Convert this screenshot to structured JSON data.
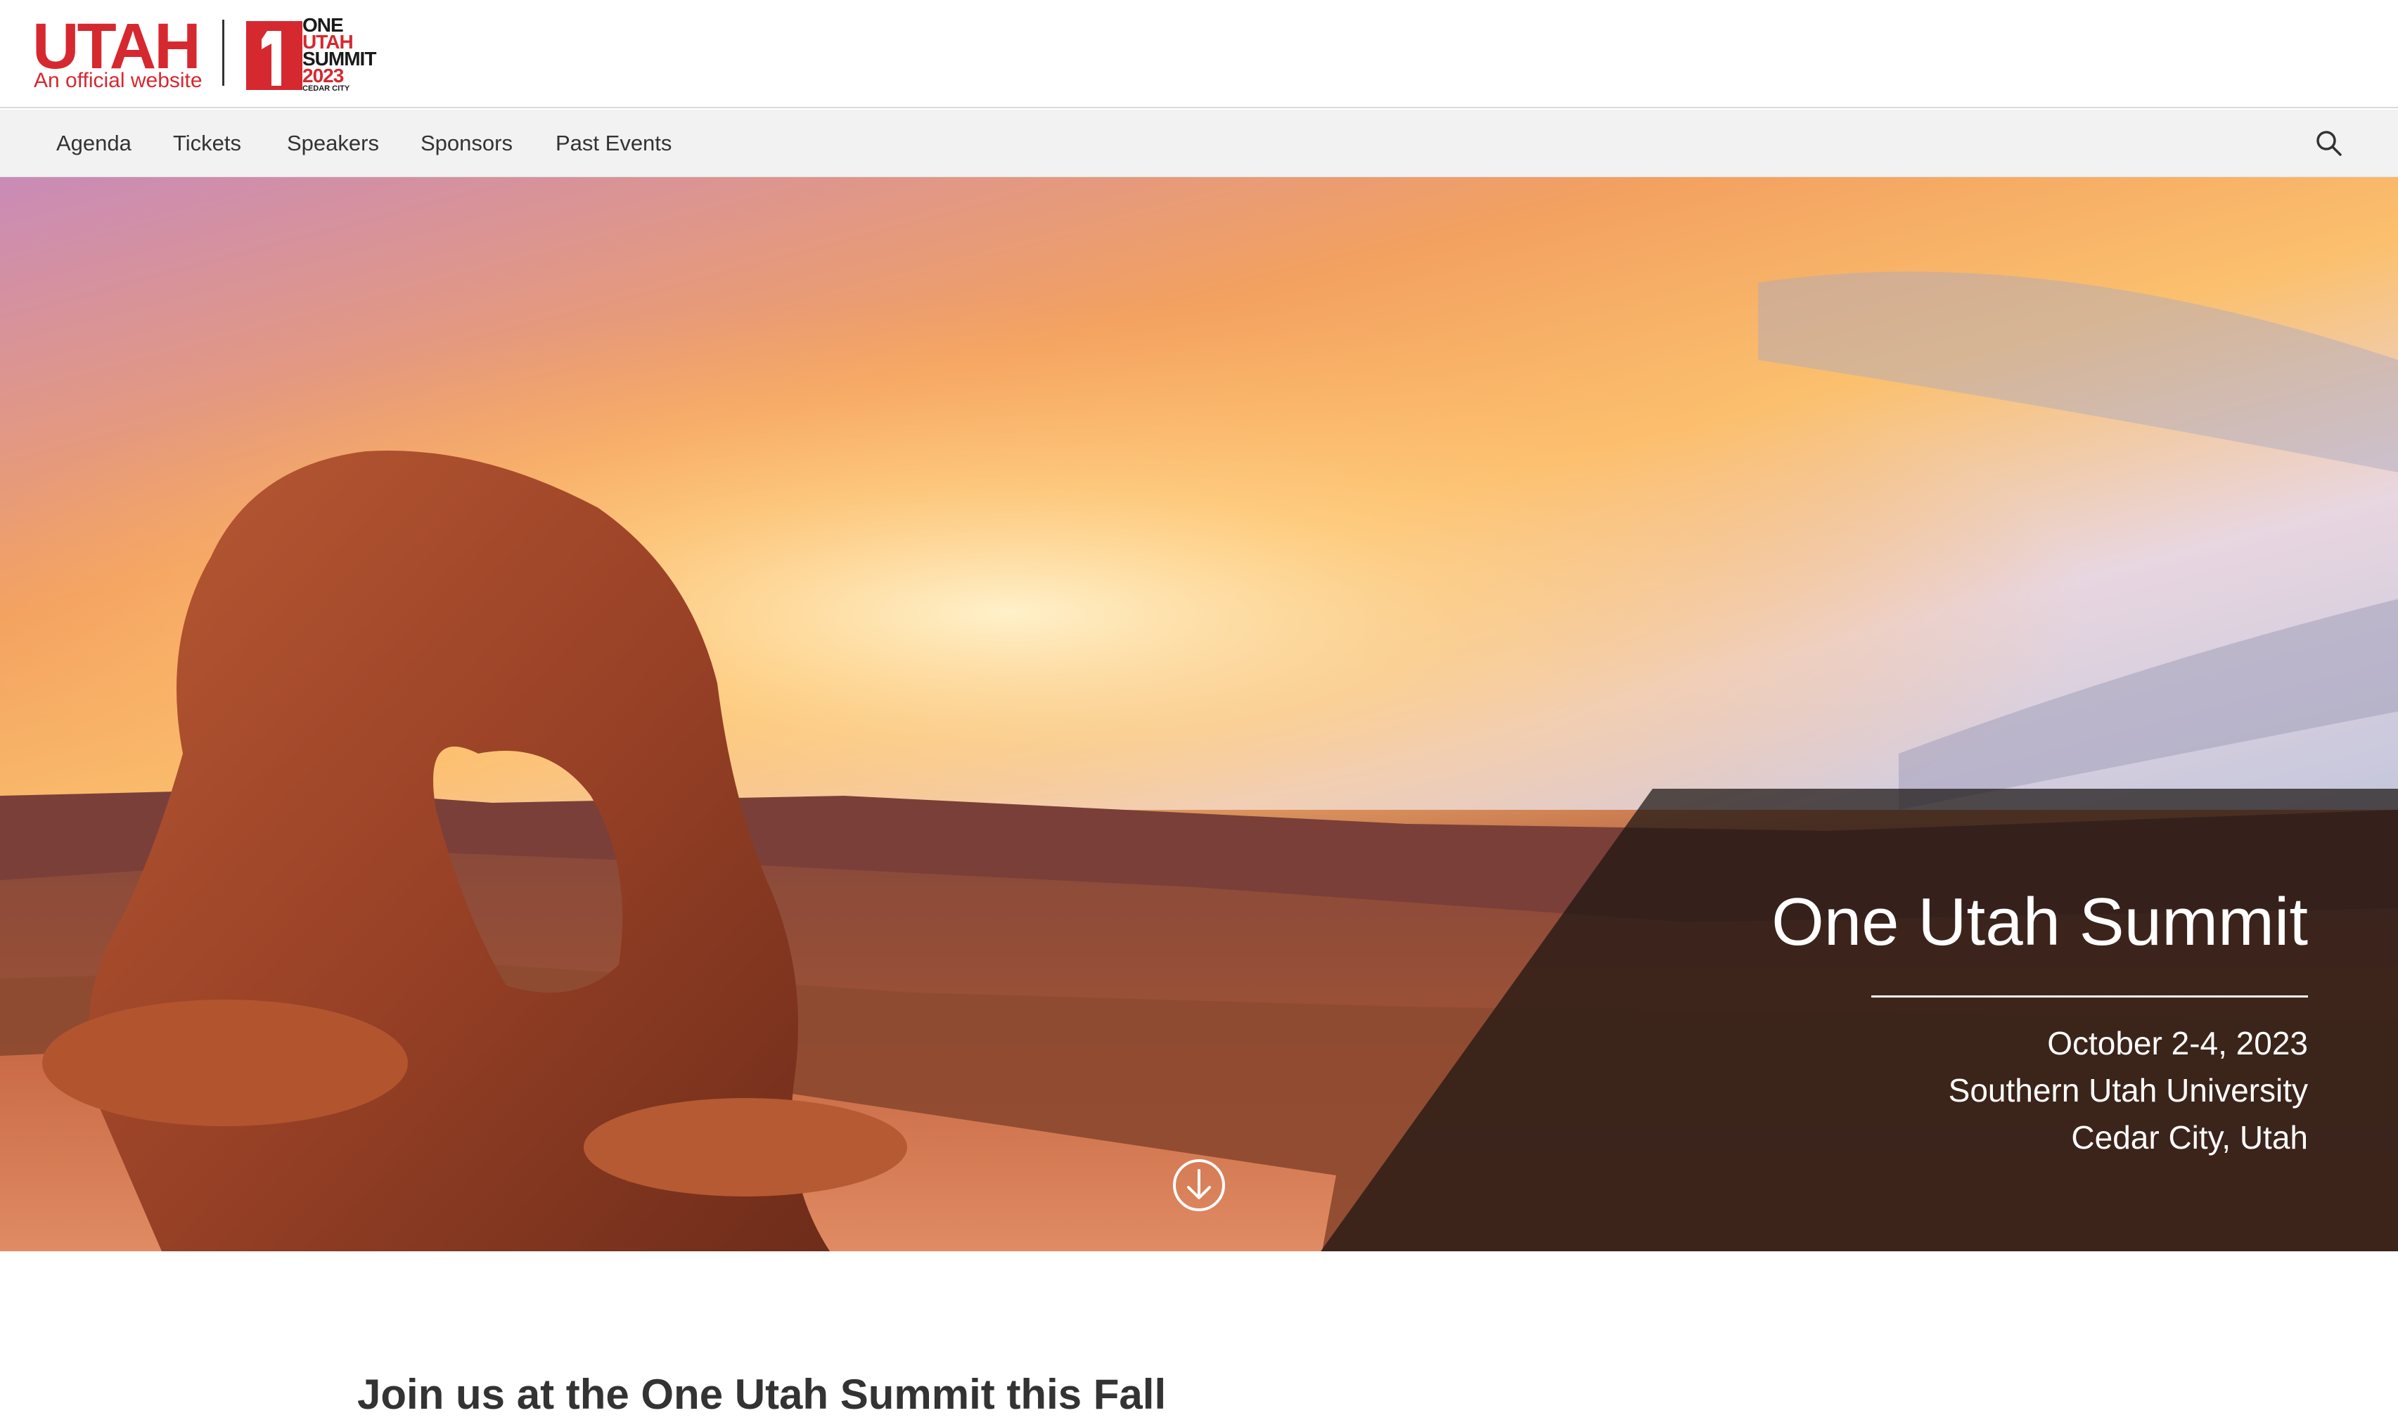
{
  "brand": {
    "name": "UTAH",
    "tagline": "An official website",
    "accent_color": "#d6282f"
  },
  "summit_logo": {
    "number": "1",
    "line1": "ONE",
    "line2": "UTAH",
    "line3": "SUMMIT",
    "line4": "2023",
    "line5": "CEDAR CITY"
  },
  "nav": {
    "items": [
      {
        "label": "Agenda"
      },
      {
        "label": "Tickets"
      },
      {
        "label": "Speakers"
      },
      {
        "label": "Sponsors"
      },
      {
        "label": "Past Events"
      }
    ],
    "search_icon": "search-icon"
  },
  "hero": {
    "title": "One Utah Summit",
    "date": "October 2-4, 2023",
    "venue": "Southern Utah University",
    "location": "Cedar City, Utah",
    "scroll_icon": "arrow-down-circle-icon"
  },
  "main": {
    "heading": "Join us at the One Utah Summit this Fall"
  }
}
